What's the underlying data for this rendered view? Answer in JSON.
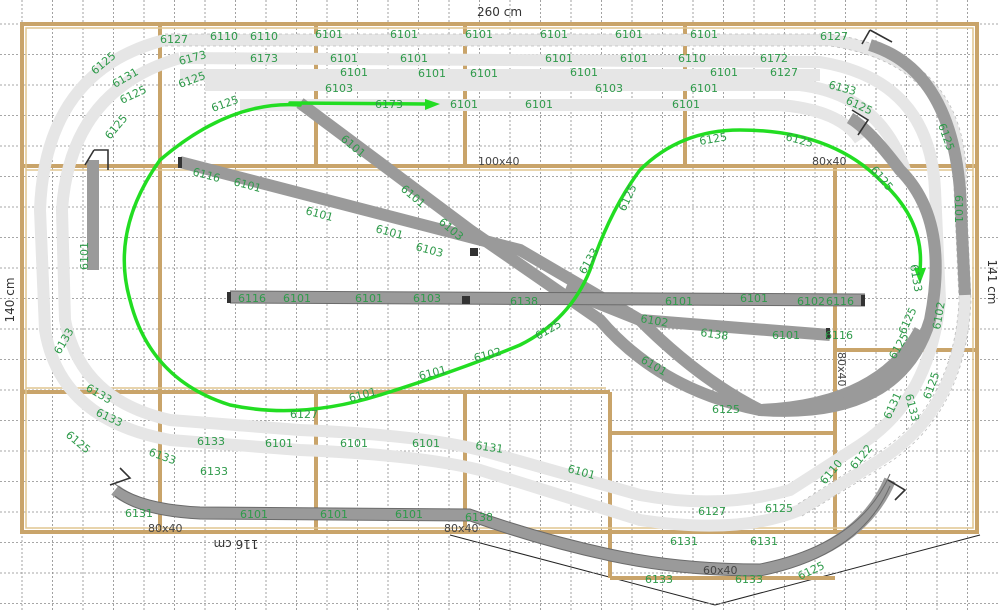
{
  "dimensions": {
    "top": "260 cm",
    "left": "140 cm",
    "right": "141 cm",
    "bottom": "116 cm"
  },
  "zones": {
    "top_center": "100x40",
    "right_upper": "80x40",
    "bottom_left": "80x40",
    "bottom_middle": "80x40",
    "bottom_right": "60x40",
    "right_side": "80x40"
  },
  "colors": {
    "frame": "#c9a46a",
    "grid": "#8a8a8a",
    "track_ghost": "#e6e6e6",
    "track_dark": "#9a9a9a",
    "label": "#2e9a4a",
    "route": "#22dd22"
  },
  "pieces": {
    "l1": "6127",
    "l2": "6110",
    "l3": "6110",
    "l4": "6101",
    "l5": "6101",
    "l6": "6101",
    "l7": "6101",
    "l8": "6101",
    "l9": "6101",
    "l10": "6125",
    "l11": "6173",
    "l12": "6131",
    "l13": "6125",
    "l14": "6173",
    "l15": "6125",
    "l16": "6125",
    "l17": "6101",
    "l18": "6101",
    "l19": "6101",
    "l20": "6103",
    "l21": "6173",
    "l22": "6101",
    "l23": "6101",
    "l24": "6103",
    "l25": "6101",
    "l26": "6133",
    "l27": "6133",
    "l28": "6133",
    "l29": "6125",
    "l30": "6133",
    "l31": "6101",
    "l32": "6101",
    "l33": "6131",
    "l34": "6101",
    "l35": "6101",
    "l36": "6127",
    "l37": "6131",
    "l38": "6131",
    "l39": "6133",
    "l40": "6133",
    "l41": "6131",
    "l42": "6101",
    "l43": "6101",
    "l44": "6138",
    "l45": "6101",
    "l46": "6133",
    "l47": "6133",
    "l48": "6125",
    "l49": "6127",
    "l50": "6101",
    "l51": "6101",
    "l52": "6103",
    "l53": "6102",
    "l54": "6101",
    "l55": "6101",
    "l56": "6101",
    "l57": "6103",
    "l58": "6102",
    "l59": "6138",
    "l60": "6101",
    "l61": "6125",
    "l62": "6125",
    "l63": "6125",
    "l64": "6133",
    "l65": "6101",
    "l66": "6101",
    "l67": "6116",
    "l68": "6101",
    "l69": "6101",
    "l70": "6103",
    "l71": "6116",
    "l72": "6101",
    "l73": "6101",
    "l74": "6102",
    "l75": "6116",
    "l76": "6116",
    "l77": "6138",
    "l78": "6101",
    "l79": "6125",
    "l80": "6101",
    "l81": "6133",
    "l82": "6125",
    "l83": "6125",
    "l84": "6127",
    "l85": "6101",
    "l86": "6101",
    "l87": "6110",
    "l88": "6101",
    "l89": "6101",
    "l90": "6172",
    "l91": "6127",
    "l92": "6133",
    "l93": "6125",
    "l94": "6125",
    "l95": "6101",
    "l96": "6101",
    "l97": "6101",
    "l98": "6125",
    "l99": "6125",
    "l100": "6101",
    "l101": "6102",
    "l102": "6125",
    "l103": "6131",
    "l104": "6122",
    "l105": "6110",
    "l106": "6125",
    "l107": "6125",
    "l108": "6133"
  }
}
